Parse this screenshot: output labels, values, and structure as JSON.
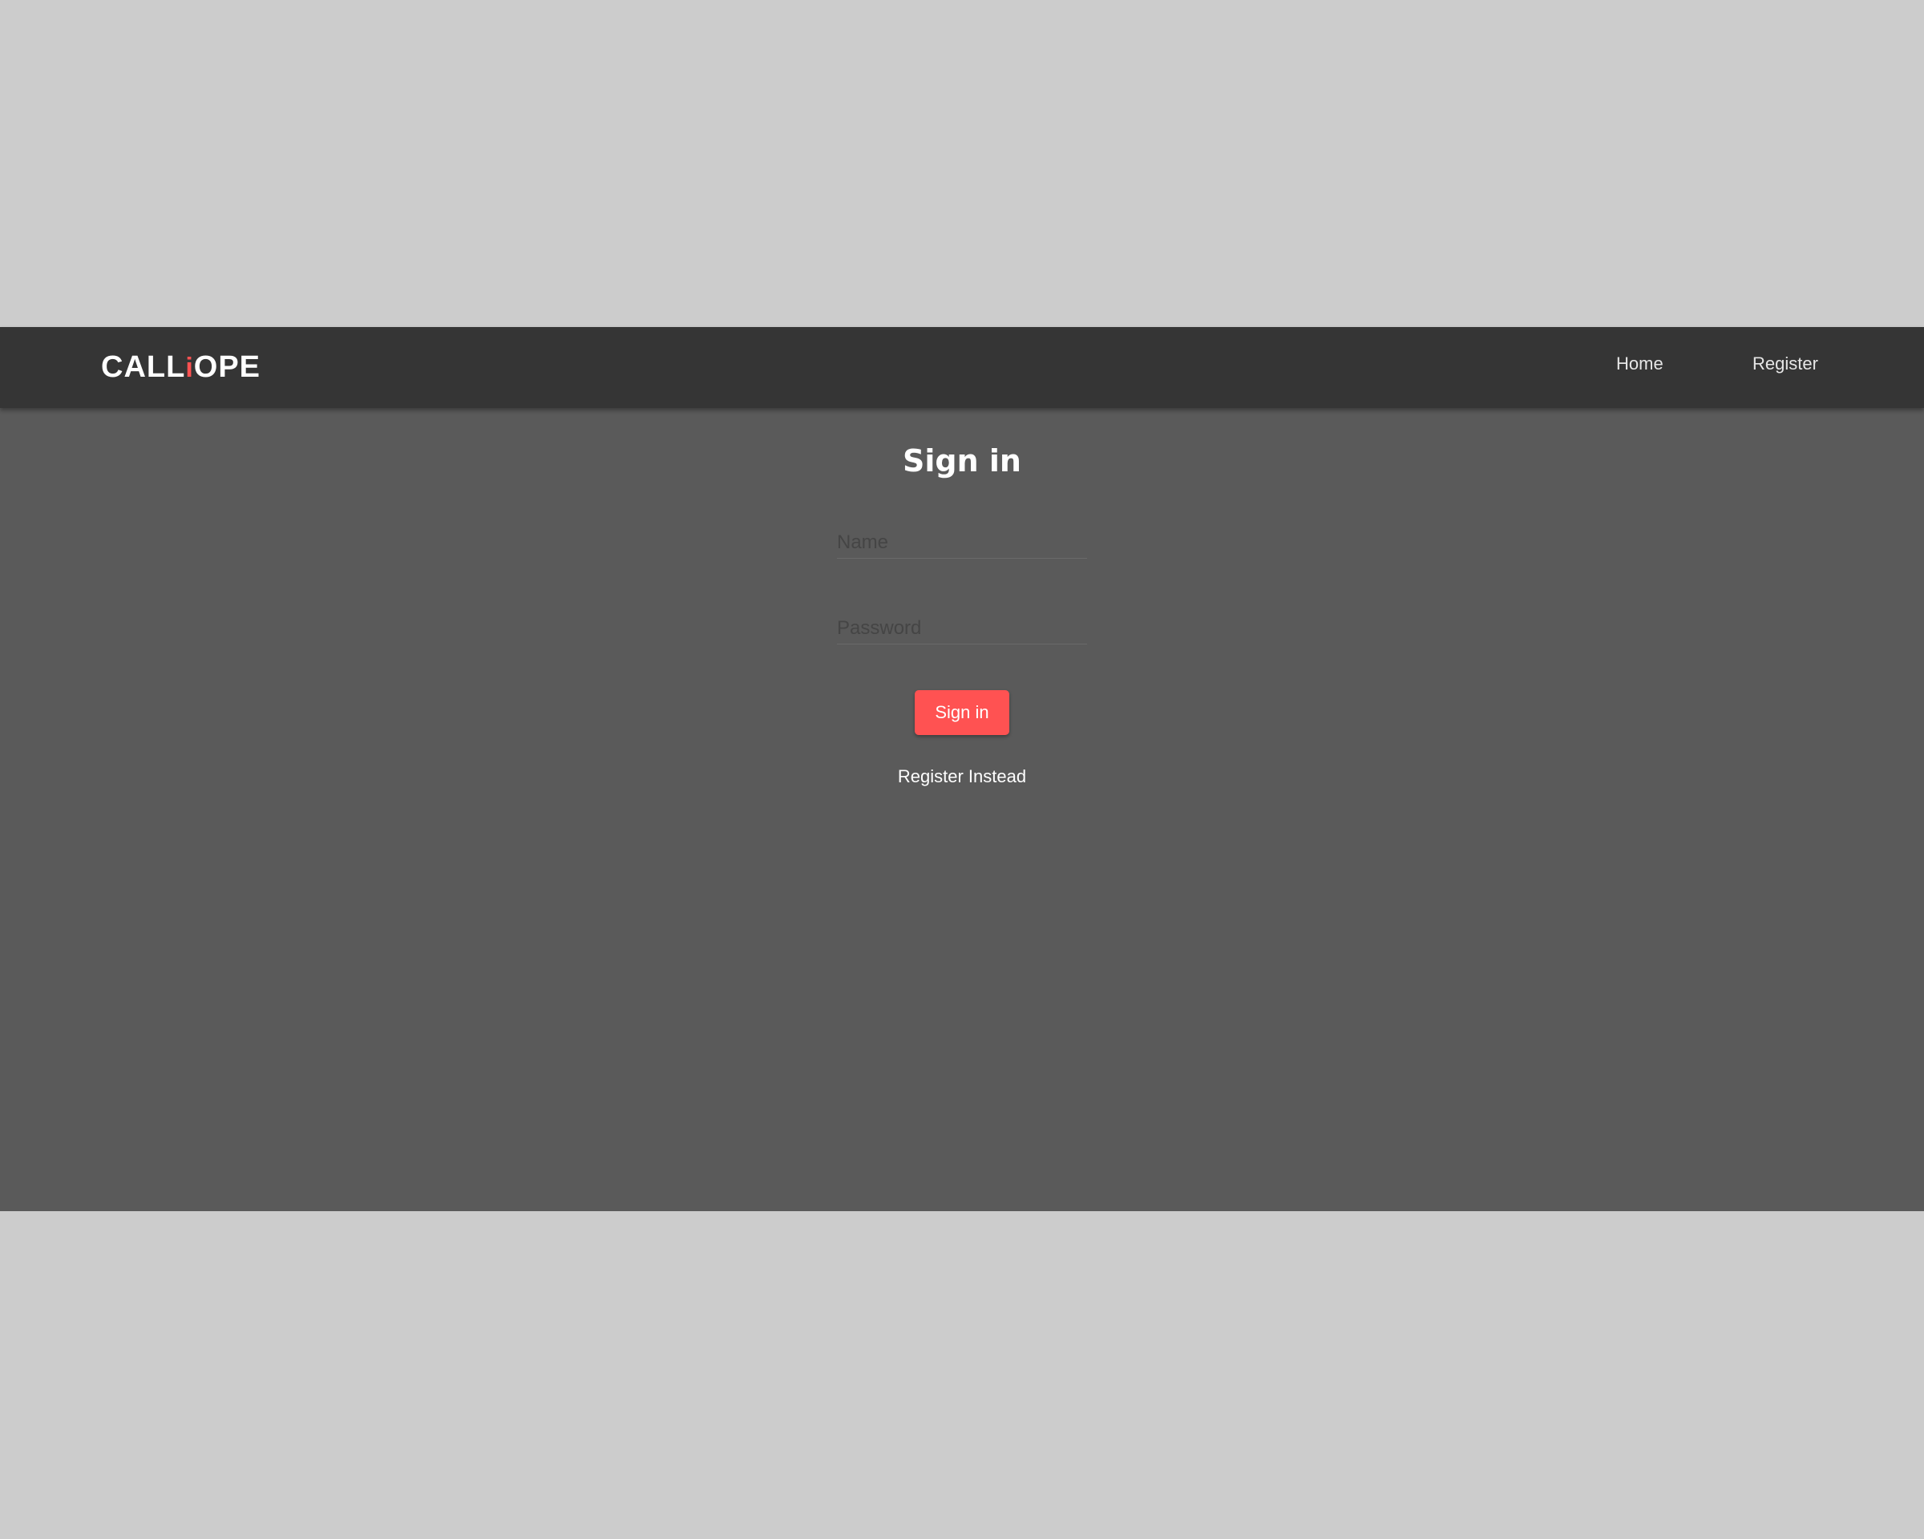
{
  "navbar": {
    "brand_prefix": "CALL",
    "brand_accent": "i",
    "brand_suffix": "OPE",
    "links": [
      {
        "label": "Home"
      },
      {
        "label": "Register"
      }
    ]
  },
  "signin": {
    "title": "Sign in",
    "name_placeholder": "Name",
    "password_placeholder": "Password",
    "submit_label": "Sign in",
    "register_link": "Register Instead"
  },
  "colors": {
    "page_background": "#cccccc",
    "app_background": "#5a5a5a",
    "navbar_background": "#353535",
    "accent": "#ff5252"
  }
}
